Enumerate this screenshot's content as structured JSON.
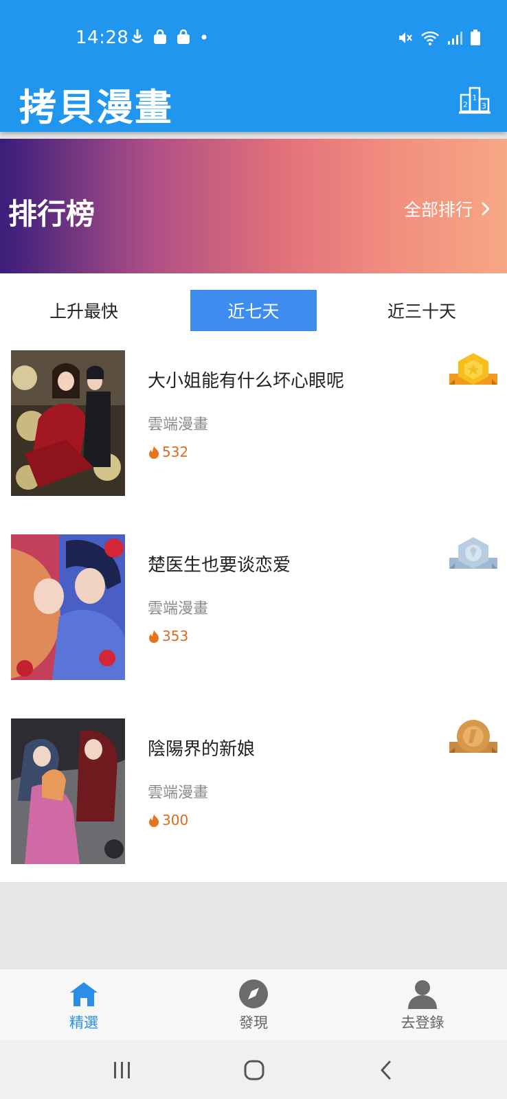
{
  "status_bar": {
    "time": "14:28"
  },
  "header": {
    "title": "拷貝漫畫",
    "rank_icon": "podium-icon"
  },
  "banner": {
    "title": "排行榜",
    "link_label": "全部排行"
  },
  "tabs": [
    {
      "label": "上升最快",
      "active": false
    },
    {
      "label": "近七天",
      "active": true
    },
    {
      "label": "近三十天",
      "active": false
    }
  ],
  "rankings": [
    {
      "rank": 1,
      "title": "大小姐能有什么坏心眼呢",
      "publisher": "雲端漫畫",
      "heat": "532",
      "medal": "gold-medal-icon"
    },
    {
      "rank": 2,
      "title": "楚医生也要谈恋爱",
      "publisher": "雲端漫畫",
      "heat": "353",
      "medal": "silver-medal-icon"
    },
    {
      "rank": 3,
      "title": "陰陽界的新娘",
      "publisher": "雲端漫畫",
      "heat": "300",
      "medal": "bronze-medal-icon"
    }
  ],
  "bottom_nav": [
    {
      "label": "精選",
      "icon": "home-icon",
      "active": true
    },
    {
      "label": "發現",
      "icon": "compass-icon",
      "active": false
    },
    {
      "label": "去登錄",
      "icon": "user-icon",
      "active": false
    }
  ],
  "colors": {
    "primary": "#2196ef",
    "tab_active": "#3f8cf1",
    "heat": "#e06a1b",
    "nav_active": "#2a8ee8"
  }
}
